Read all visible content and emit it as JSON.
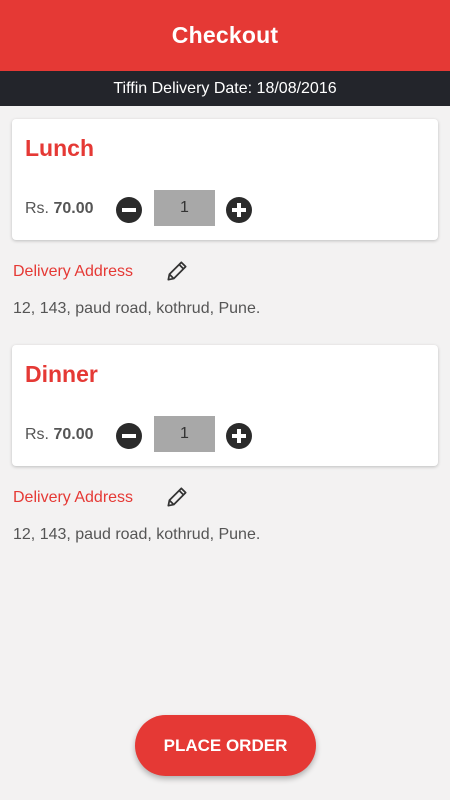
{
  "app_bar": {
    "title": "Checkout"
  },
  "delivery_date": {
    "label": "Tiffin Delivery Date:",
    "value": "18/08/2016"
  },
  "orders": [
    {
      "meal": "Lunch",
      "price_prefix": "Rs.",
      "price": "70.00",
      "quantity": "1",
      "address_label": "Delivery Address",
      "address": "12, 143, paud road, kothrud, Pune."
    },
    {
      "meal": "Dinner",
      "price_prefix": "Rs.",
      "price": "70.00",
      "quantity": "1",
      "address_label": "Delivery Address",
      "address": "12, 143, paud road, kothrud, Pune."
    }
  ],
  "actions": {
    "place_order_label": "PLACE ORDER"
  },
  "colors": {
    "accent": "#e53935",
    "strip": "#23252b",
    "background": "#f3f2f2"
  },
  "icons": [
    "minus-circle-icon",
    "plus-circle-icon",
    "pencil-icon"
  ]
}
